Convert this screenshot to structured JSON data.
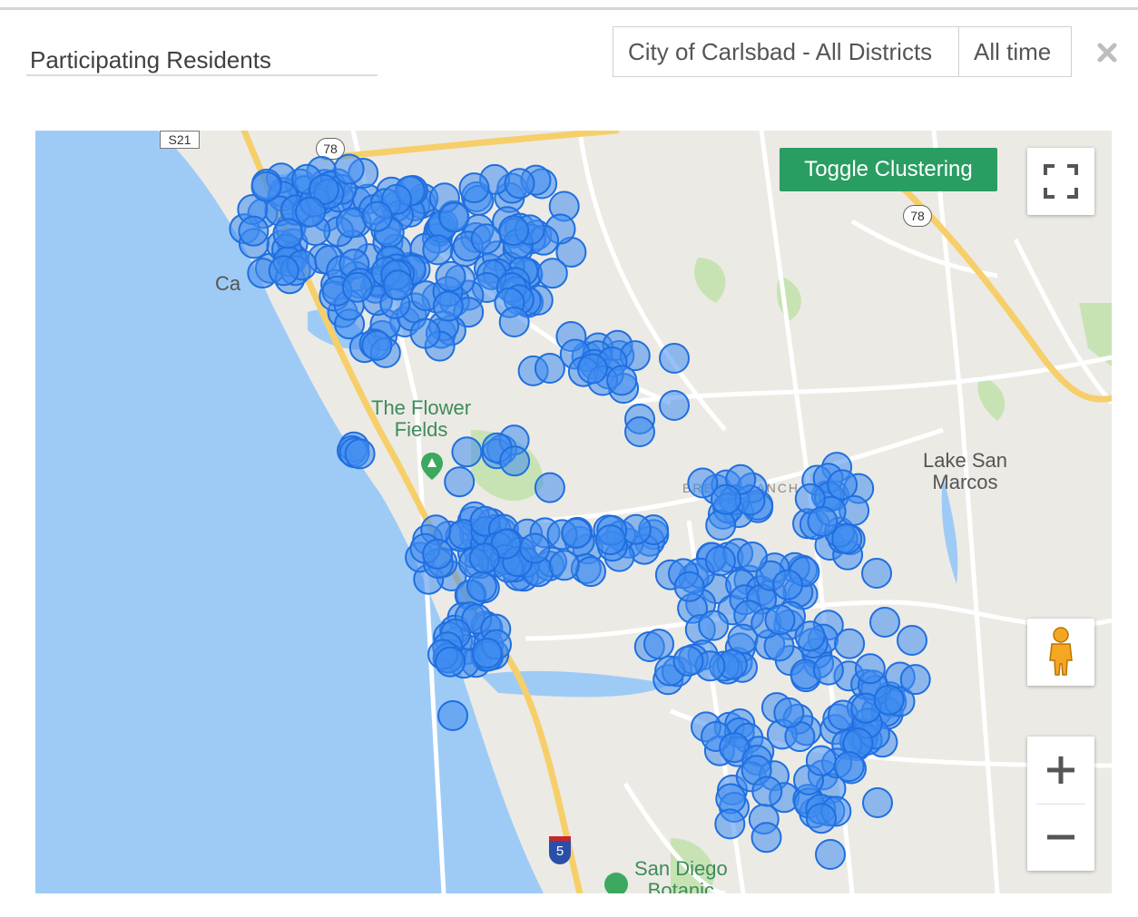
{
  "header": {
    "title": "Participating Residents",
    "district_filter": "City of Carlsbad - All Districts",
    "time_filter": "All time"
  },
  "map": {
    "toggle_clustering_label": "Toggle Clustering",
    "labels": {
      "flower_fields": "The Flower\nFields",
      "lake_san_marcos": "Lake San\nMarcos",
      "san_diego_botanic": "San Diego\nBotanic",
      "bressi_ranch": "BRESSI RANCH",
      "city_partial": "Ca"
    },
    "road_shields": {
      "s21": "S21",
      "r78_top": "78",
      "r78_right": "78",
      "i5": "5"
    },
    "icons": {
      "close": "close-icon",
      "fullscreen": "fullscreen-icon",
      "pegman": "pegman-icon",
      "zoom_in": "plus-icon",
      "zoom_out": "minus-icon"
    },
    "colors": {
      "ocean": "#9ecbf6",
      "land": "#eceae5",
      "marker_fill": "#3f8cf0",
      "marker_stroke": "#1f6fe0",
      "toggle_button": "#2a9d63",
      "highway": "#f6cf6a"
    }
  }
}
